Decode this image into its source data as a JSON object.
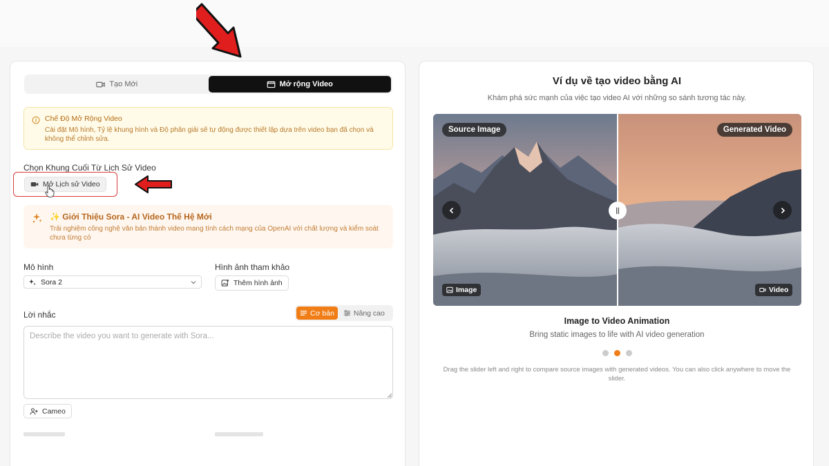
{
  "colors": {
    "accent": "#f07d16",
    "annotation_red": "#e01e1e",
    "active_tab": "#111111"
  },
  "tabs": [
    {
      "label": "Tạo Mới",
      "icon": "video-icon"
    },
    {
      "label": "Mở rộng Video",
      "icon": "film-icon"
    }
  ],
  "alert": {
    "title": "Chế Độ Mở Rộng Video",
    "desc": "Cài đặt Mô hình, Tỷ lệ khung hình và Độ phân giải sẽ tự động được thiết lập dựa trên video bạn đã chọn và không thể chỉnh sửa.",
    "icon": "info-icon"
  },
  "history": {
    "label": "Chọn Khung Cuối Từ Lịch Sử Video",
    "button": "Mở Lịch sử Video"
  },
  "sora_card": {
    "title": "✨ Giới Thiệu Sora - AI Video Thế Hệ Mới",
    "desc": "Trải nghiệm công nghệ văn bản thành video mang tính cách mạng của OpenAI với chất lượng và kiểm soát chưa từng có",
    "icon": "sparkles-icon"
  },
  "model": {
    "label": "Mô hình",
    "value": "Sora 2"
  },
  "reference": {
    "label": "Hình ảnh tham khảo",
    "button": "Thêm hình ảnh"
  },
  "prompt": {
    "label": "Lời nhắc",
    "mode_basic": "Cơ bản",
    "mode_advanced": "Nâng cao",
    "placeholder": "Describe the video you want to generate with Sora..."
  },
  "cameo": {
    "label": "Cameo"
  },
  "showcase": {
    "title": "Ví dụ về tạo video bằng AI",
    "subtitle": "Khám phá sức mạnh của việc tạo video AI với những so sánh tương tác này.",
    "source_label": "Source Image",
    "generated_label": "Generated Video",
    "image_tag": "Image",
    "video_tag": "Video",
    "slider_glyph": "||",
    "caption_title": "Image to Video Animation",
    "caption_sub": "Bring static images to life with AI video generation",
    "active_slide": 2,
    "slide_count": 3,
    "hint": "Drag the slider left and right to compare source images with generated videos. You can also click anywhere to move the slider."
  }
}
